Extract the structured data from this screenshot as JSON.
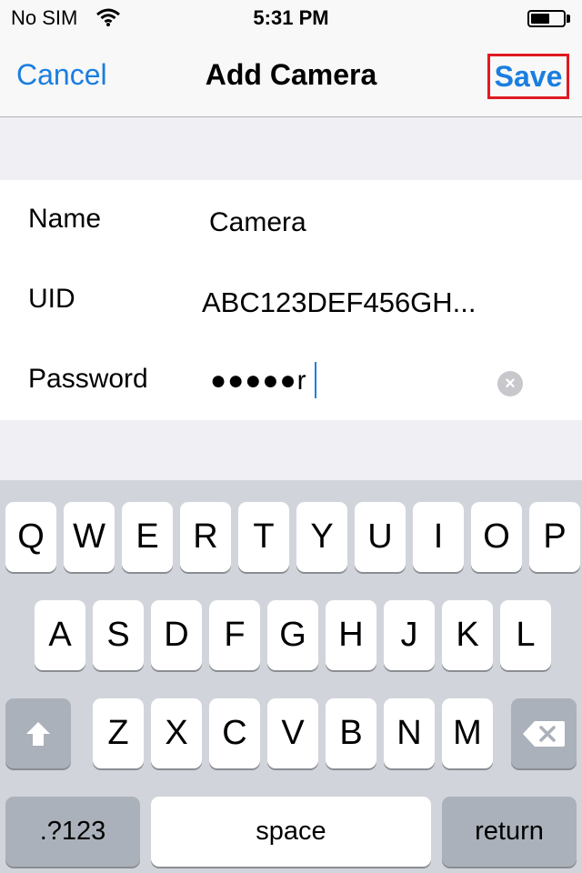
{
  "status_bar": {
    "carrier": "No SIM",
    "time": "5:31 PM",
    "battery_level": 0.6
  },
  "nav": {
    "cancel_label": "Cancel",
    "title": "Add Camera",
    "save_label": "Save",
    "accent_color": "#1a7ee0",
    "highlight_color": "#e01a22"
  },
  "form": {
    "name_label": "Name",
    "name_value": "Camera",
    "uid_label": "UID",
    "uid_value": "ABC123DEF456GH...",
    "password_label": "Password",
    "password_value": "●●●●●r"
  },
  "keyboard": {
    "row1": [
      "Q",
      "W",
      "E",
      "R",
      "T",
      "Y",
      "U",
      "I",
      "O",
      "P"
    ],
    "row2": [
      "A",
      "S",
      "D",
      "F",
      "G",
      "H",
      "J",
      "K",
      "L"
    ],
    "row3": [
      "Z",
      "X",
      "C",
      "V",
      "B",
      "N",
      "M"
    ],
    "numbers_label": ".?123",
    "space_label": "space",
    "return_label": "return"
  }
}
